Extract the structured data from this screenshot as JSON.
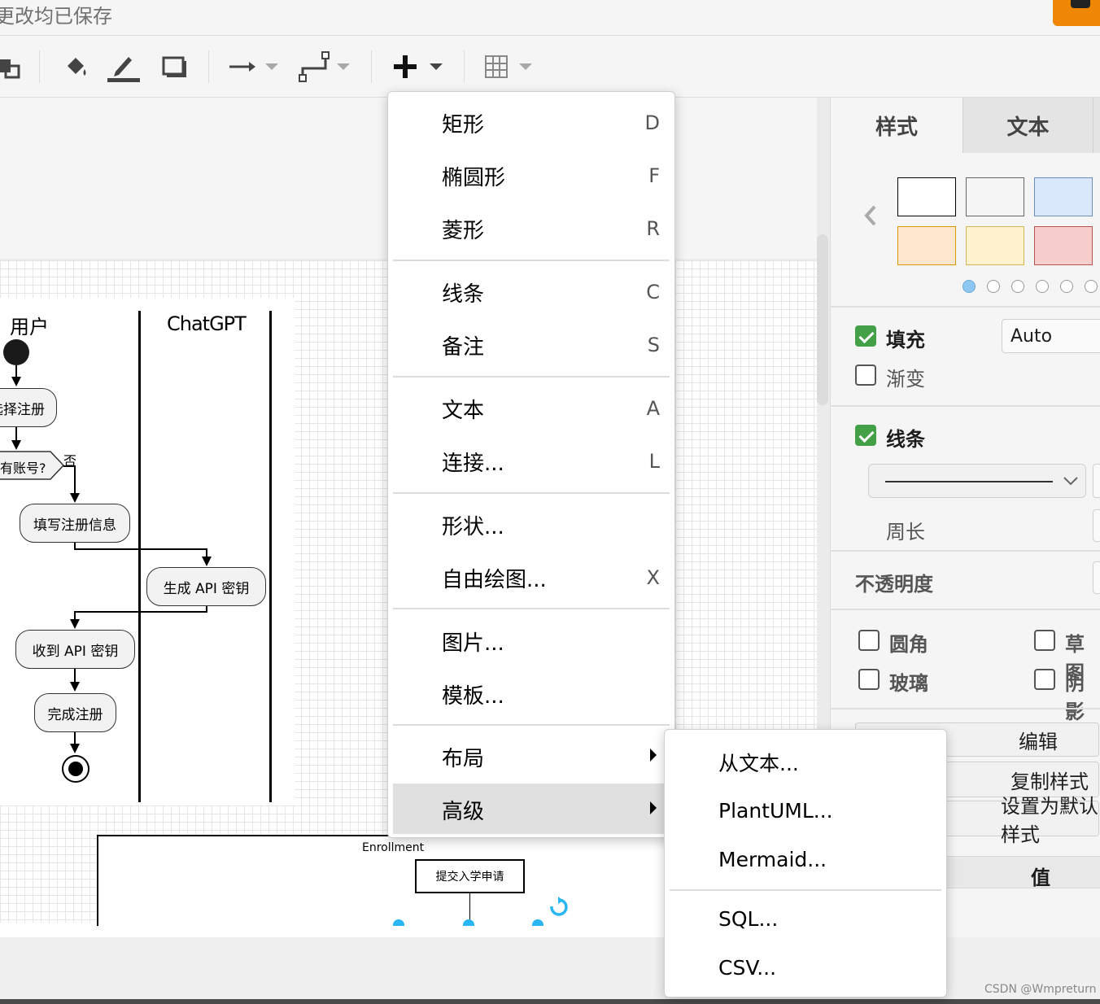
{
  "header": {
    "save_status": "更改均已保存"
  },
  "insert_menu": {
    "items": [
      {
        "label": "矩形",
        "key": "D"
      },
      {
        "label": "椭圆形",
        "key": "F"
      },
      {
        "label": "菱形",
        "key": "R"
      },
      {
        "label": "线条",
        "key": "C"
      },
      {
        "label": "备注",
        "key": "S"
      },
      {
        "label": "文本",
        "key": "A"
      },
      {
        "label": "连接...",
        "key": "L"
      },
      {
        "label": "形状...",
        "key": ""
      },
      {
        "label": "自由绘图...",
        "key": "X"
      },
      {
        "label": "图片...",
        "key": ""
      },
      {
        "label": "模板...",
        "key": ""
      },
      {
        "label": "布局",
        "key": ""
      },
      {
        "label": "高级",
        "key": ""
      }
    ]
  },
  "advanced_submenu": {
    "items": [
      "从文本...",
      "PlantUML...",
      "Mermaid...",
      "SQL...",
      "CSV..."
    ]
  },
  "diagram": {
    "lane_user": "用户",
    "lane_chatgpt": "ChatGPT",
    "nodes": {
      "choose_register": "选择注册",
      "has_account": "有账号?",
      "no_label": "否",
      "fill_info": "填写注册信息",
      "gen_key": "生成 API 密钥",
      "recv_key": "收到 API 密钥",
      "done": "完成注册"
    },
    "enrollment_title": "Enrollment",
    "apply_node": "提交入学申请"
  },
  "format_panel": {
    "tabs": [
      "样式",
      "文本"
    ],
    "swatch_colors": [
      "#ffffff",
      "#f5f5f5",
      "#dae8fc",
      "#ffe6cc",
      "#fff2cc",
      "#f8cecc"
    ],
    "swatch_borders": [
      "#000000",
      "#666666",
      "#6c8ebf",
      "#d79b00",
      "#d6b656",
      "#b85450"
    ],
    "fill_label": "填充",
    "fill_value": "Auto",
    "gradient_label": "渐变",
    "line_label": "线条",
    "perimeter_label": "周长",
    "opacity_label": "不透明度",
    "rounded_label": "圆角",
    "sketch_label": "草图",
    "glass_label": "玻璃",
    "shadow_label": "阴影",
    "edit_button": "编辑",
    "copy_style_button": "复制样式",
    "set_default_button": "设置为默认样式",
    "value_header": "值"
  },
  "watermark": "CSDN @Wmpreturn",
  "colors": {
    "accent_orange": "#f08705",
    "check_green": "#43a047",
    "menu_highlight": "#e0e0e0"
  }
}
